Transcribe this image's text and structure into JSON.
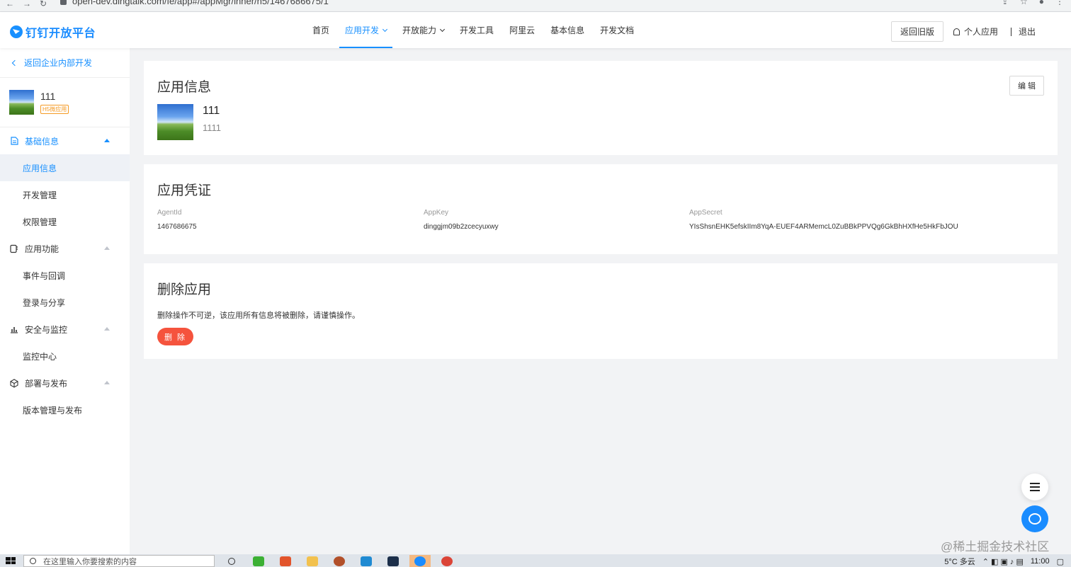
{
  "browser": {
    "url": "open-dev.dingtalk.com/fe/app#/appMgr/inner/h5/1467686675/1"
  },
  "header": {
    "logo_text": "钉钉开放平台",
    "nav": [
      {
        "label": "首页",
        "active": false,
        "dropdown": false
      },
      {
        "label": "应用开发",
        "active": true,
        "dropdown": true
      },
      {
        "label": "开放能力",
        "active": false,
        "dropdown": true
      },
      {
        "label": "开发工具",
        "active": false,
        "dropdown": false
      },
      {
        "label": "阿里云",
        "active": false,
        "dropdown": false
      },
      {
        "label": "基本信息",
        "active": false,
        "dropdown": false
      },
      {
        "label": "开发文档",
        "active": false,
        "dropdown": false
      }
    ],
    "old_version_label": "返回旧版",
    "personal_label": "个人应用",
    "logout_label": "退出"
  },
  "sidebar": {
    "back_label": "返回企业内部开发",
    "app_name": "111",
    "app_tag": "H5微应用",
    "groups": [
      {
        "label": "基础信息",
        "icon": "document-icon",
        "open": true,
        "items": [
          {
            "label": "应用信息",
            "active": true
          },
          {
            "label": "开发管理",
            "active": false
          },
          {
            "label": "权限管理",
            "active": false
          }
        ]
      },
      {
        "label": "应用功能",
        "icon": "app-function-icon",
        "open": false,
        "items": [
          {
            "label": "事件与回调",
            "active": false
          },
          {
            "label": "登录与分享",
            "active": false
          }
        ]
      },
      {
        "label": "安全与监控",
        "icon": "bar-chart-icon",
        "open": false,
        "items": [
          {
            "label": "监控中心",
            "active": false
          }
        ]
      },
      {
        "label": "部署与发布",
        "icon": "cube-icon",
        "open": false,
        "items": [
          {
            "label": "版本管理与发布",
            "active": false
          }
        ]
      }
    ]
  },
  "app_info": {
    "title": "应用信息",
    "edit_label": "编 辑",
    "name": "111",
    "description": "1111"
  },
  "credentials": {
    "title": "应用凭证",
    "fields": [
      {
        "label": "AgentId",
        "value": "1467686675"
      },
      {
        "label": "AppKey",
        "value": "dinggjm09b2zcecyuxwy"
      },
      {
        "label": "AppSecret",
        "value": "YIsShsnEHK5efskIIm8YqA-EUEF4ARMemcL0ZuBBkPPVQg6GkBhHXfHe5HkFbJOU"
      }
    ]
  },
  "delete_app": {
    "title": "删除应用",
    "description": "删除操作不可逆，该应用所有信息将被删除，请谨慎操作。",
    "button_label": "删 除"
  },
  "watermark": "@稀土掘金技术社区",
  "taskbar": {
    "search_placeholder": "在这里输入你要搜索的内容",
    "weather": "5°C 多云",
    "time": "11:00"
  },
  "colors": {
    "accent": "#1890ff",
    "danger": "#f5533d",
    "tag": "#f59a23"
  }
}
